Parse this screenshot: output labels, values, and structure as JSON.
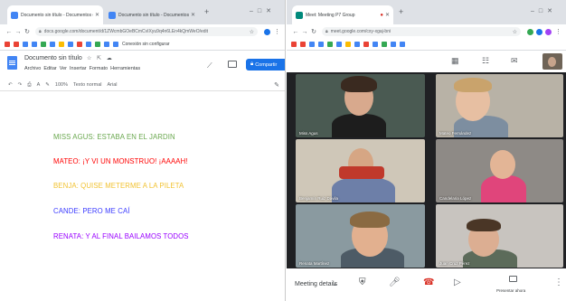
{
  "left_window": {
    "tabs": [
      {
        "title": "Documento sin título - Documentos de Google",
        "active": true,
        "favicon_color": "#4285f4"
      },
      {
        "title": "Documento sin título - Documentos de Google",
        "active": false,
        "favicon_color": "#4285f4"
      }
    ],
    "url": "docs.google.com/document/d/1ZWcmbGOeBCmCvIXyu9q4n6LEn4kQmWeO/edit",
    "bookmarks_label": "Conexión sin configurar",
    "docs": {
      "title": "Documento sin título",
      "menu": [
        "Archivo",
        "Editar",
        "Ver",
        "Insertar",
        "Formato",
        "Herramientas"
      ],
      "share_label": "Compartir",
      "toolbar": {
        "zoom": "100%",
        "style": "Texto normal",
        "font": "Arial"
      }
    },
    "document_lines": [
      {
        "text": "MISS AGUS: ESTABA EN EL JARDIN",
        "color": "#6aa84f"
      },
      {
        "text": "MATEO: ¡Y VI UN MONSTRUO! ¡AAAAH!",
        "color": "#ff0000"
      },
      {
        "text": "BENJA: QUISE METERME A LA PILETA",
        "color": "#f1c232"
      },
      {
        "text": "CANDE: PERO ME CAÍ",
        "color": "#3c3cff"
      },
      {
        "text": "RENATA: Y AL FINAL BAILAMOS TODOS",
        "color": "#9900ff"
      }
    ]
  },
  "right_window": {
    "tabs": [
      {
        "title": "Meet: Meeting P7 Group",
        "active": true,
        "favicon_color": "#00897b"
      }
    ],
    "url": "meet.google.com/cxy-xgaj-bni",
    "participants": [
      "Miss Agus",
      "Mateo Fernández",
      "Benjamín Ruiz Dávila",
      "Candelaria López",
      "Renata Martínez",
      "Juan Cruz Pérez"
    ],
    "controls": {
      "details_label": "Meeting details",
      "present_label": "Presentar ahora"
    }
  }
}
